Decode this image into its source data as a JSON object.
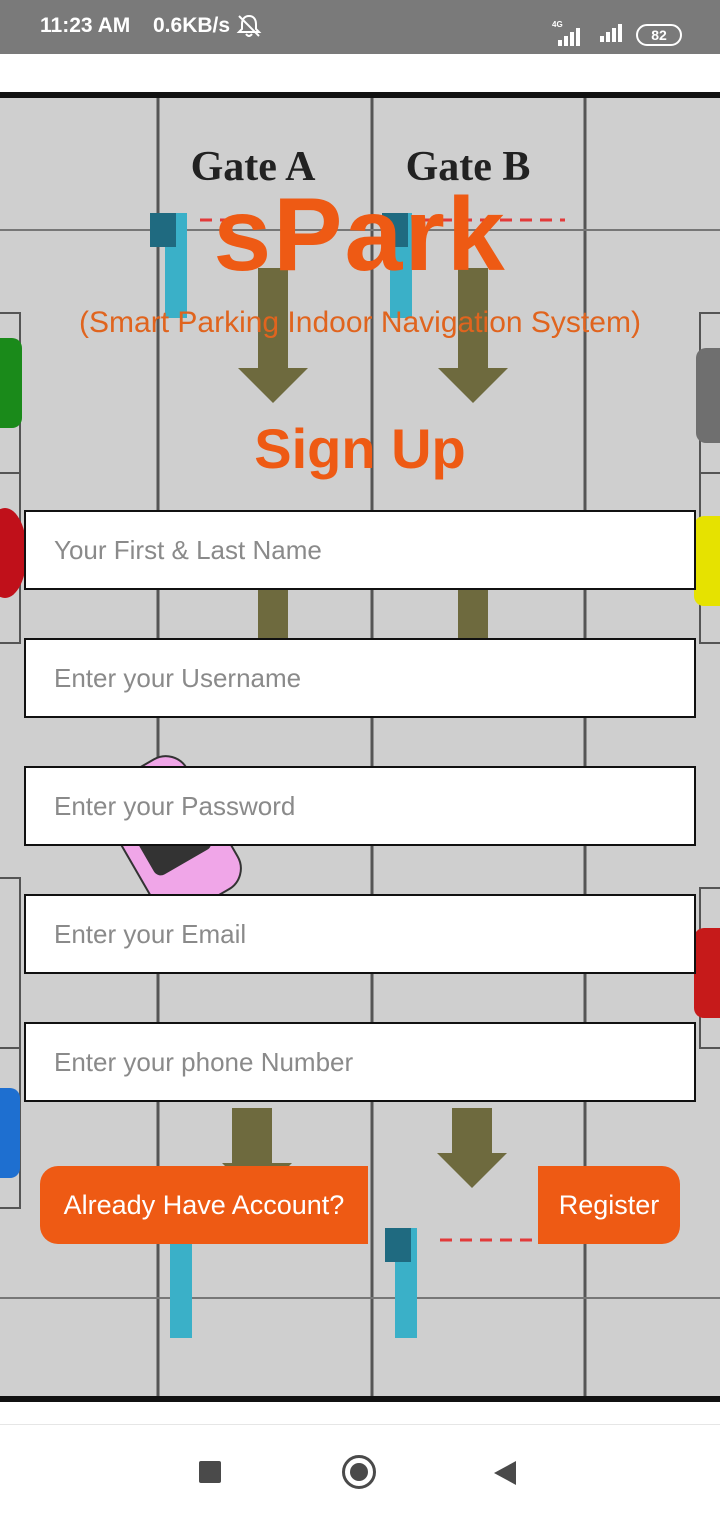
{
  "status_bar": {
    "time": "11:23 AM",
    "speed": "0.6KB/s",
    "network": "4G",
    "battery": "82"
  },
  "background": {
    "gate_a": "Gate A",
    "gate_b": "Gate B"
  },
  "header": {
    "title": "sPark",
    "subtitle": "(Smart Parking Indoor Navigation System)"
  },
  "form": {
    "heading": "Sign Up",
    "fields": {
      "name_placeholder": "Your First & Last Name",
      "username_placeholder": "Enter your Username",
      "password_placeholder": "Enter your Password",
      "email_placeholder": "Enter your Email",
      "phone_placeholder": "Enter your phone Number"
    },
    "buttons": {
      "login_label": "Already Have Account?",
      "register_label": "Register"
    }
  },
  "colors": {
    "accent": "#ee5a14",
    "status_bar": "#7a7a7a"
  },
  "icons": {
    "status": [
      "muted-bell-icon",
      "signal-icon",
      "battery-icon"
    ],
    "nav": [
      "recents-square-icon",
      "home-circle-icon",
      "back-triangle-icon"
    ]
  }
}
